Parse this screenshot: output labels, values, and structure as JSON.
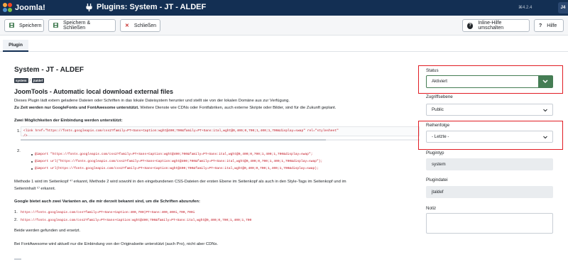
{
  "header": {
    "logo_text": "Joomla!",
    "page_title": "Plugins: System - JT - ALDEF",
    "version": "⌘4.2.4",
    "user_initials": "J4"
  },
  "toolbar": {
    "save": "Speichern",
    "save_close": "Speichern & Schließen",
    "close": "Schließen",
    "inline_help": "Inline-Hilfe umschalten",
    "help": "Hilfe"
  },
  "tabs": [
    {
      "label": "Plugin"
    }
  ],
  "plugin": {
    "title": "System - JT - ALDEF",
    "badge_group": "system",
    "badge_element": "jtaldef",
    "badge_sep": "/",
    "subtitle": "JoomTools - Automatic local download external files",
    "desc_line1": "Dieses Plugin lädt extern geladene Dateien oder Schriften in das lokale Dateisystem herunter und stellt sie von der lokalen Domäne aus zur Verfügung.",
    "desc_bold": "Zu Zeit werden nur GoogleFonts und FontAwesome unterstützt.",
    "desc_rest": " Weitere Dienste wie CDNs oder Fontfabriken, auch externe Skripte oder Bilder, sind für die Zukunft geplant.",
    "options_heading": "Zwei Möglichkeiten der Einbindung werden unterstützt:",
    "option1_num": "1.",
    "option1_code": "<link href=\"https://fonts.googleapis.com/css2?family=PT+Sans+Caption:wght@400;700&family=PT+Sans:ital,wght@0,400;0,700;1,400;1,700&display=swap\" rel=\"stylesheet\"",
    "option1_code_end": "/>",
    "option2_num": "2.",
    "option2_codes": [
      "@import \"https://fonts.googleapis.com/css2?family=PT+Sans+Caption:wght@400;700&family=PT+Sans:ital,wght@0,400;0,700;1,400;1,700&display=swap\";",
      "@import url(\"https://fonts.googleapis.com/css2?family=PT+Sans+Caption:wght@400;700&family=PT+Sans:ital,wght@0,400;0,700;1,400;1,700&display=swap\");",
      "@import url(https://fonts.googleapis.com/css2?family=PT+Sans+Caption:wght@400;700&family=PT+Sans:ital,wght@0,400;0,700;1,400;1,700&display=swap);"
    ],
    "method_line1": "Methode 1 wird im Seitenkopf ⁴⁾ erkannt, Methode 2 wird sowohl in den eingebundenen CSS-Dateien der ersten Ebene im Seitenkopf als auch in den Style-Tags im Seitenkopf und im",
    "method_line2": "Seiteninhalt ⁵⁾ erkannt.",
    "variants_heading": "Google bietet auch zwei Varianten an, die mir derzeit bekannt sind, um die Schriften abzurufen:",
    "variant1_num": "1.",
    "variant1_code": "https://fonts.googleapis.com/css?family=PT+Sans+Caption:400,700|PT+Sans:400,400i,700,700i",
    "variant2_num": "2.",
    "variant2_code": "https://fonts.googleapis.com/css2?family=PT+Sans+Caption:wght@400;700&family=PT+Sans:ital,wght@0,400;0,700;1,400;1,700",
    "both_found": "Beide werden gefunden und ersetzt.",
    "fontawesome_note": "Bei FontAwesome wird aktuell nur die Einbindung von der Originalseite unterstützt (auch Pro), nicht aber CDNs."
  },
  "side": {
    "status_label": "Status",
    "status_value": "Aktiviert",
    "access_label": "Zugriffsebene",
    "access_value": "Public",
    "order_label": "Reihenfolge",
    "order_value": "- Letzte -",
    "type_label": "Plugintyp",
    "type_value": "system",
    "file_label": "Plugindatei",
    "file_value": "jtaldef",
    "note_label": "Notiz",
    "note_value": ""
  },
  "colors": {
    "header_bg": "#132f53",
    "success": "#457d54",
    "danger": "#c52827",
    "highlight": "#e11d24",
    "code": "#c1121f"
  }
}
